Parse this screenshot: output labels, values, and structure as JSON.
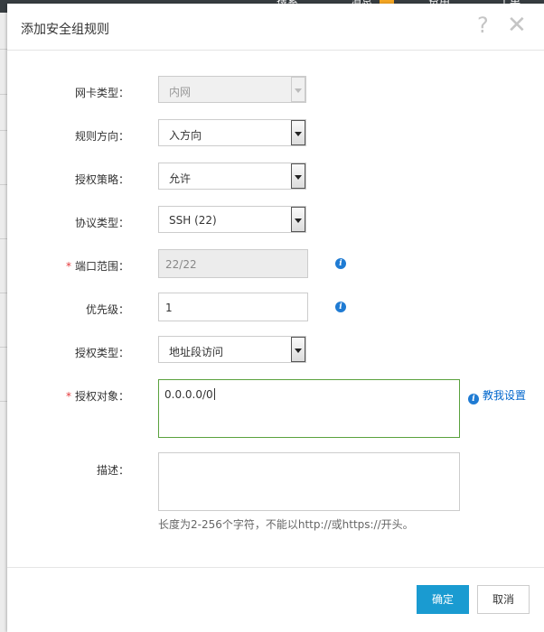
{
  "background": {
    "topbar_peek": [
      "搜索",
      "消息",
      "费用",
      "工单"
    ]
  },
  "dialog": {
    "title": "添加安全组规则",
    "help_glyph": "?",
    "close_glyph": "✕"
  },
  "form": {
    "nic_type": {
      "label": "网卡类型：",
      "value": "内网"
    },
    "direction": {
      "label": "规则方向：",
      "value": "入方向"
    },
    "policy": {
      "label": "授权策略：",
      "value": "允许"
    },
    "protocol": {
      "label": "协议类型：",
      "value": "SSH (22)"
    },
    "port_range": {
      "label": "端口范围：",
      "required_mark": "*",
      "value": "22/22"
    },
    "priority": {
      "label": "优先级：",
      "value": "1"
    },
    "auth_type": {
      "label": "授权类型：",
      "value": "地址段访问"
    },
    "auth_object": {
      "label": "授权对象：",
      "required_mark": "*",
      "value": "0.0.0.0/0",
      "guide_link": "教我设置"
    },
    "description": {
      "label": "描述：",
      "value": "",
      "hint": "长度为2-256个字符，不能以http://或https://开头。"
    }
  },
  "buttons": {
    "ok": "确定",
    "cancel": "取消"
  },
  "colors": {
    "primary": "#1a9bd1",
    "required": "#e4393c",
    "link": "#0066cc",
    "focus_border": "#5aa13d"
  }
}
